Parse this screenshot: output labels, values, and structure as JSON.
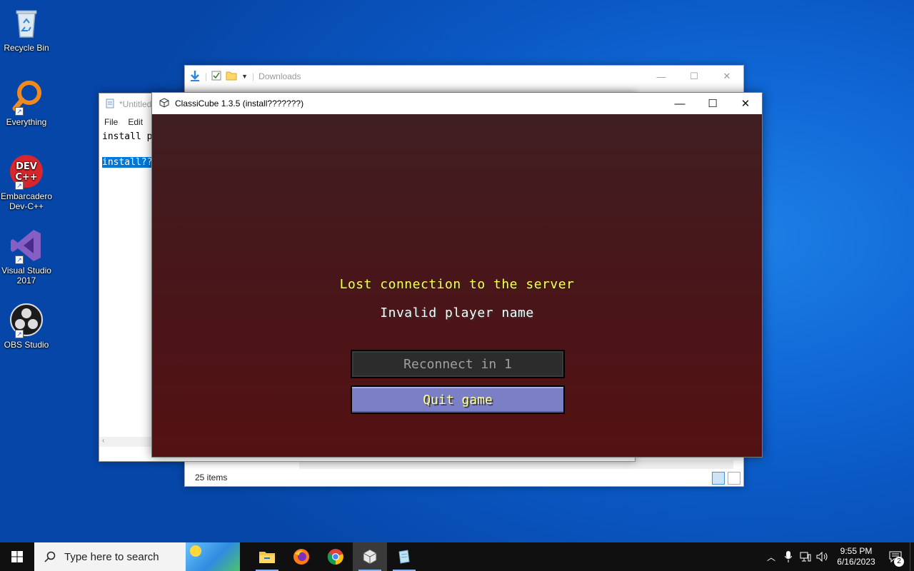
{
  "desktop": {
    "icons": [
      {
        "label": "Recycle Bin"
      },
      {
        "label": "Everything"
      },
      {
        "label": "Embarcadero Dev-C++"
      },
      {
        "label": "Visual Studio 2017"
      },
      {
        "label": "OBS Studio"
      }
    ]
  },
  "explorer": {
    "title": "Downloads",
    "status": "25 items"
  },
  "notepad": {
    "title": "*Untitled",
    "menu": [
      "File",
      "Edit"
    ],
    "line1": "install p",
    "line2_selected": "install??"
  },
  "classicube": {
    "title": "ClassiCube 1.3.5 (install???????)",
    "message_title": "Lost connection to the server",
    "message_reason": "Invalid player name",
    "reconnect_label": "Reconnect in 1",
    "quit_label": "Quit game"
  },
  "taskbar": {
    "search_placeholder": "Type here to search",
    "time": "9:55 PM",
    "date": "6/16/2023",
    "notification_count": "2"
  },
  "colors": {
    "game_title": "#ffff55",
    "game_background": "#4a1519",
    "quit_button": "#7b7fc6",
    "accent": "#0078d7"
  }
}
